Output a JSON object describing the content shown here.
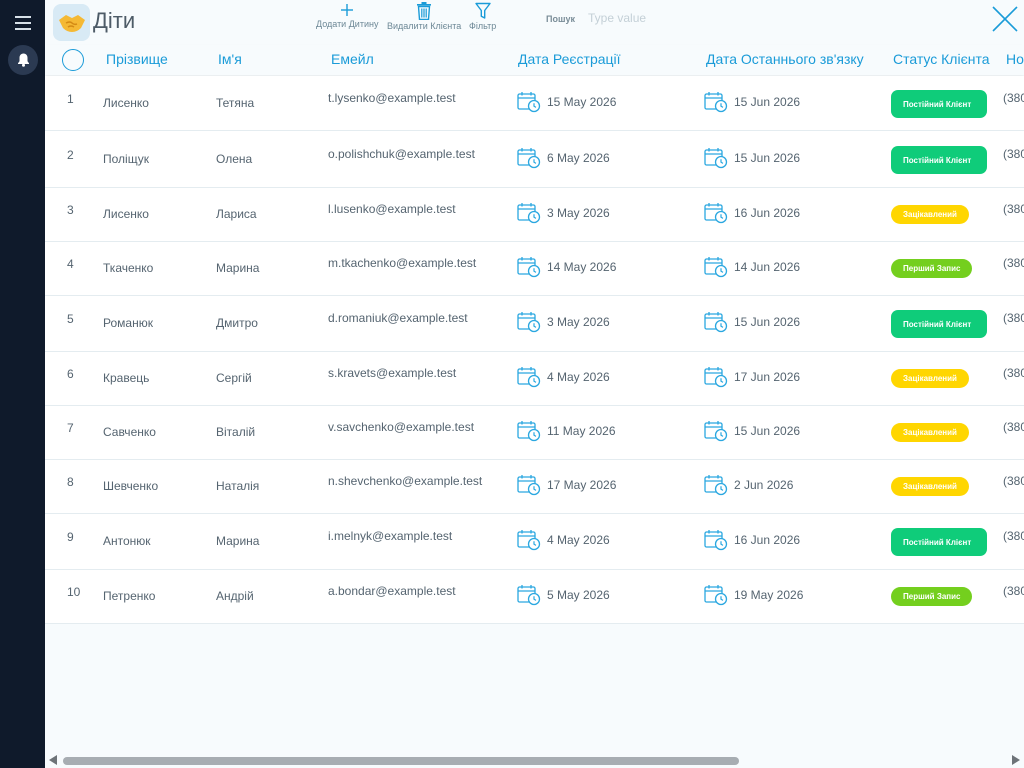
{
  "app": {
    "title": "Діти",
    "logo_icon": "handshake-icon",
    "colors": {
      "accent": "#1a9bd8",
      "sidebar": "#0f1a2b",
      "badge_regular": "#0fcc7a",
      "badge_interested": "#ffd600",
      "badge_first": "#74cf1e"
    }
  },
  "sidebar": {
    "items": [
      {
        "icon": "menu-icon"
      },
      {
        "icon": "bell-icon"
      },
      {
        "icon": "phone-icon"
      }
    ]
  },
  "toolbar": {
    "add_label": "Додати Дитину",
    "delete_label": "Видалити Клієнта",
    "filter_label": "Фільтр",
    "search_label": "Пошук",
    "search_placeholder": "Type value",
    "search_value": ""
  },
  "table": {
    "columns": [
      "Прізвище",
      "Ім'я",
      "Емейл",
      "Дата Реєстрації",
      "Дата Останнього зв'язку",
      "Статус Клієнта",
      "Но"
    ],
    "rows": [
      {
        "idx": "1",
        "surname": "Лисенко",
        "name": "Тетяна",
        "email": "t.lysenko@example.test",
        "reg": "15 May 2026",
        "last": "15 Jun 2026",
        "status": "Постійний Клієнт",
        "status_type": "green",
        "phone": "(380"
      },
      {
        "idx": "2",
        "surname": "Поліщук",
        "name": "Олена",
        "email": "o.polishchuk@example.test",
        "reg": "6 May 2026",
        "last": "15 Jun 2026",
        "status": "Постійний Клієнт",
        "status_type": "green",
        "phone": "(380"
      },
      {
        "idx": "3",
        "surname": "Лисенко",
        "name": "Лариса",
        "email": "l.lusenko@example.test",
        "reg": "3 May 2026",
        "last": "16 Jun 2026",
        "status": "Зацікавлений",
        "status_type": "yellow",
        "phone": "(380"
      },
      {
        "idx": "4",
        "surname": "Ткаченко",
        "name": "Марина",
        "email": "m.tkachenko@example.test",
        "reg": "14 May 2026",
        "last": "14 Jun 2026",
        "status": "Перший Запис",
        "status_type": "lime",
        "phone": "(380"
      },
      {
        "idx": "5",
        "surname": "Романюк",
        "name": "Дмитро",
        "email": "d.romaniuk@example.test",
        "reg": "3 May 2026",
        "last": "15 Jun 2026",
        "status": "Постійний Клієнт",
        "status_type": "green",
        "phone": "(380"
      },
      {
        "idx": "6",
        "surname": "Кравець",
        "name": "Сергій",
        "email": "s.kravets@example.test",
        "reg": "4 May 2026",
        "last": "17 Jun 2026",
        "status": "Зацікавлений",
        "status_type": "yellow",
        "phone": "(380"
      },
      {
        "idx": "7",
        "surname": "Савченко",
        "name": "Віталій",
        "email": "v.savchenko@example.test",
        "reg": "11 May 2026",
        "last": "15 Jun 2026",
        "status": "Зацікавлений",
        "status_type": "yellow",
        "phone": "(380"
      },
      {
        "idx": "8",
        "surname": "Шевченко",
        "name": "Наталія",
        "email": "n.shevchenko@example.test",
        "reg": "17 May 2026",
        "last": "2 Jun 2026",
        "status": "Зацікавлений",
        "status_type": "yellow",
        "phone": "(380"
      },
      {
        "idx": "9",
        "surname": "Антонюк",
        "name": "Марина",
        "email": "i.melnyk@example.test",
        "reg": "4 May 2026",
        "last": "16 Jun 2026",
        "status": "Постійний Клієнт",
        "status_type": "green",
        "phone": "(380"
      },
      {
        "idx": "10",
        "surname": "Петренко",
        "name": "Андрій",
        "email": "a.bondar@example.test",
        "reg": "5 May 2026",
        "last": "19 May 2026",
        "status": "Перший Запис",
        "status_type": "lime",
        "phone": "(380"
      }
    ]
  }
}
